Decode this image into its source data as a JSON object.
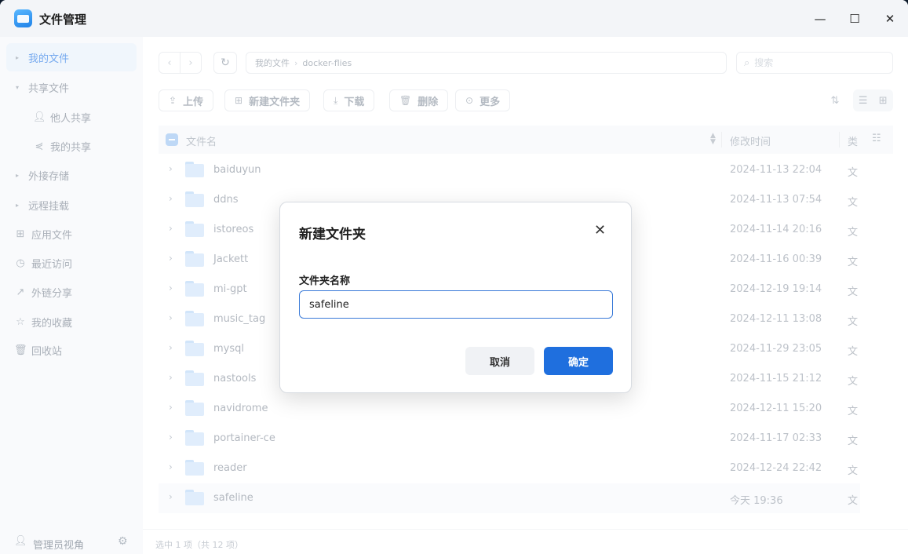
{
  "window": {
    "title": "文件管理",
    "minimize": "—",
    "maximize": "☐",
    "close": "✕"
  },
  "sidebar": {
    "my_files": "我的文件",
    "shared_files": "共享文件",
    "others_shared": "他人共享",
    "my_shared": "我的共享",
    "external_storage": "外接存储",
    "remote_mount": "远程挂载",
    "app_files": "应用文件",
    "recent": "最近访问",
    "link_share": "外链分享",
    "favorites": "我的收藏",
    "recycle_bin": "回收站",
    "admin_view": "管理员视角"
  },
  "nav": {
    "back": "‹",
    "forward": "›",
    "refresh": "↻",
    "path": [
      "我的文件",
      "docker-flies"
    ],
    "path_sep": "›",
    "search_placeholder": "搜索"
  },
  "toolbar": {
    "upload": "上传",
    "new_folder": "新建文件夹",
    "download": "下载",
    "delete": "删除",
    "more": "更多"
  },
  "table": {
    "col_name": "文件名",
    "col_mtime": "修改时间",
    "col_type": "类",
    "rows": [
      {
        "name": "baiduyun",
        "mtime": "2024-11-13 22:04",
        "type": "文"
      },
      {
        "name": "ddns",
        "mtime": "2024-11-13 07:54",
        "type": "文"
      },
      {
        "name": "istoreos",
        "mtime": "2024-11-14 20:16",
        "type": "文"
      },
      {
        "name": "Jackett",
        "mtime": "2024-11-16 00:39",
        "type": "文"
      },
      {
        "name": "mi-gpt",
        "mtime": "2024-12-19 19:14",
        "type": "文"
      },
      {
        "name": "music_tag",
        "mtime": "2024-12-11 13:08",
        "type": "文"
      },
      {
        "name": "mysql",
        "mtime": "2024-11-29 23:05",
        "type": "文"
      },
      {
        "name": "nastools",
        "mtime": "2024-11-15 21:12",
        "type": "文"
      },
      {
        "name": "navidrome",
        "mtime": "2024-12-11 15:20",
        "type": "文"
      },
      {
        "name": "portainer-ce",
        "mtime": "2024-11-17 02:33",
        "type": "文"
      },
      {
        "name": "reader",
        "mtime": "2024-12-24 22:42",
        "type": "文"
      },
      {
        "name": "safeline",
        "mtime": "今天 19:36",
        "type": "文"
      }
    ]
  },
  "status": {
    "selection": "选中 1 项（共 12 项）"
  },
  "dialog": {
    "title": "新建文件夹",
    "close": "✕",
    "label": "文件夹名称",
    "value": "safeline",
    "cancel": "取消",
    "confirm": "确定"
  },
  "colors": {
    "accent": "#1f6fde",
    "folder": "#cfe4fb",
    "sidebar_active": "#e9f1fb"
  }
}
